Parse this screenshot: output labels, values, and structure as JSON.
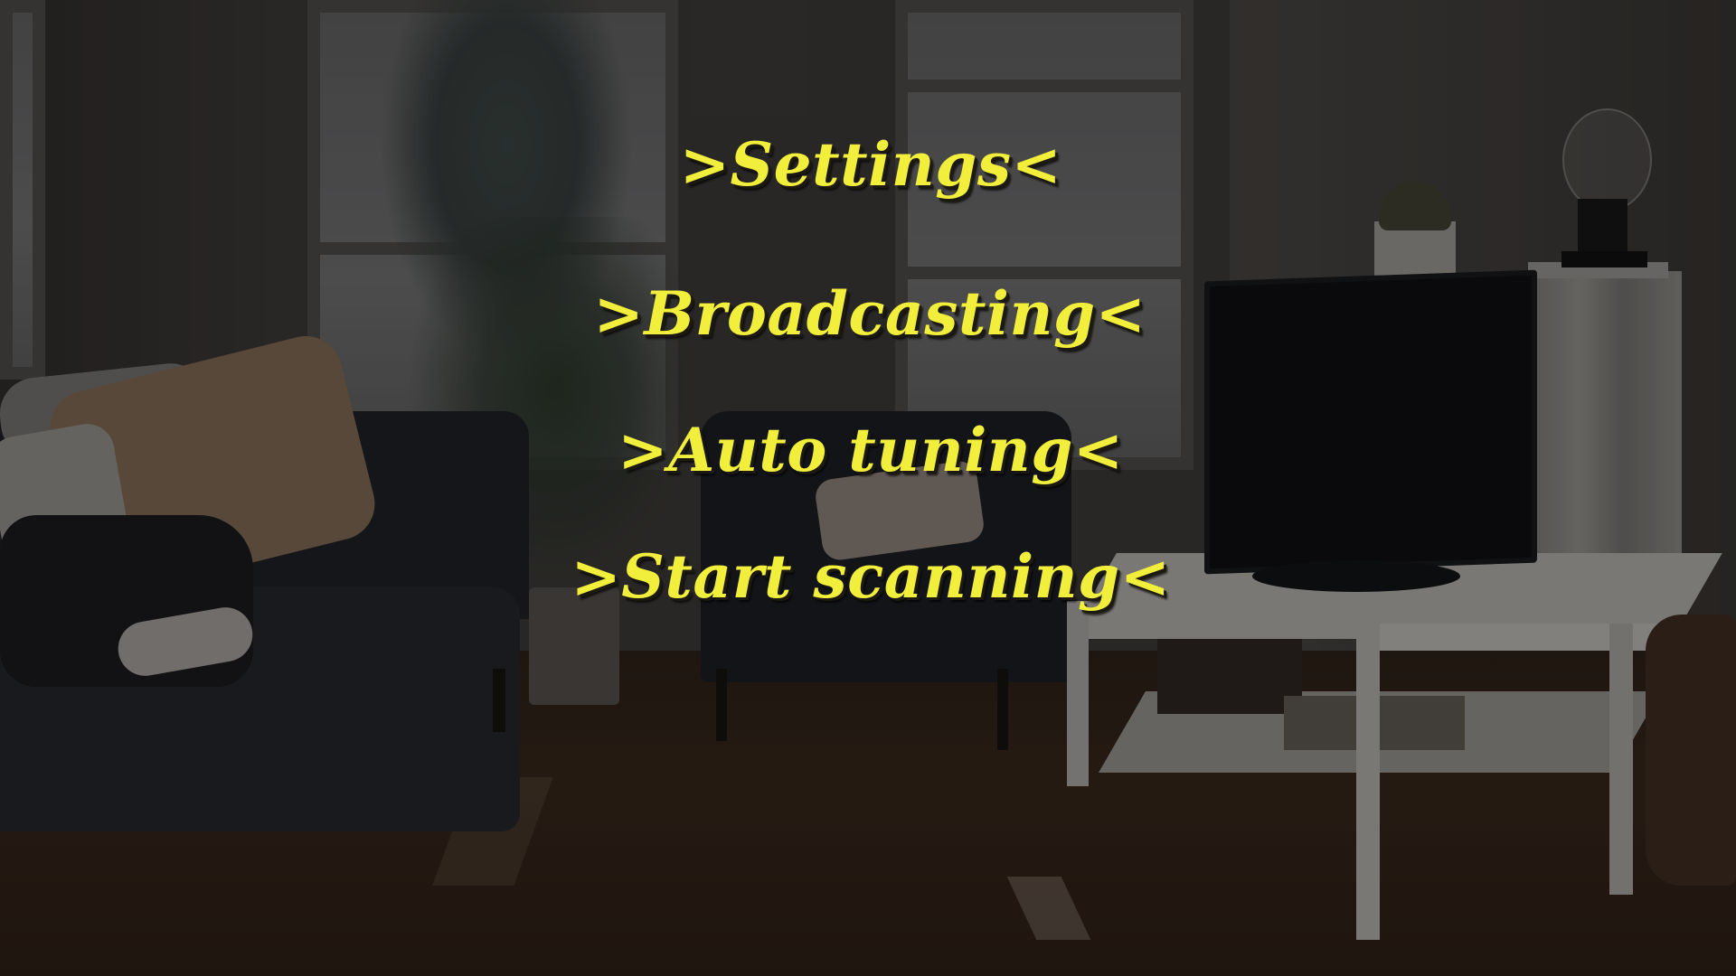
{
  "menu": {
    "items": [
      {
        "label": ">Settings<"
      },
      {
        "label": ">Broadcasting<"
      },
      {
        "label": ">Auto tuning<"
      },
      {
        "label": ">Start scanning<"
      }
    ]
  },
  "colors": {
    "menu_text": "#f2ee3c",
    "menu_shadow": "#1c1a10"
  }
}
